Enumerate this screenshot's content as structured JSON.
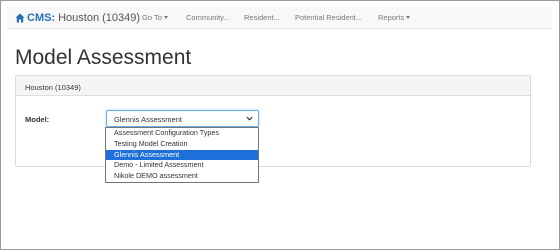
{
  "navbar": {
    "brand": "CMS:",
    "site": "Houston (10349)",
    "items": [
      {
        "label": "Go To",
        "has_caret": true
      },
      {
        "label": "Community...",
        "has_caret": false
      },
      {
        "label": "Resident...",
        "has_caret": false
      },
      {
        "label": "Potential Resident...",
        "has_caret": false
      },
      {
        "label": "Reports",
        "has_caret": true
      }
    ]
  },
  "page": {
    "title": "Model Assessment"
  },
  "panel": {
    "heading": "Houston (10349)",
    "model_label": "Model:",
    "selected_value": "Glennis Assessment"
  },
  "dropdown": {
    "options": [
      "Assessment Configuration Types",
      "Testing Model Creation",
      "Glennis Assessment",
      "Demo - Limited Assessment",
      "Nikole DEMO assessment"
    ],
    "selected_index": 2
  },
  "colors": {
    "brand": "#2a6fb5",
    "selection": "#1e6fd9",
    "focus_border": "#66afe9"
  }
}
